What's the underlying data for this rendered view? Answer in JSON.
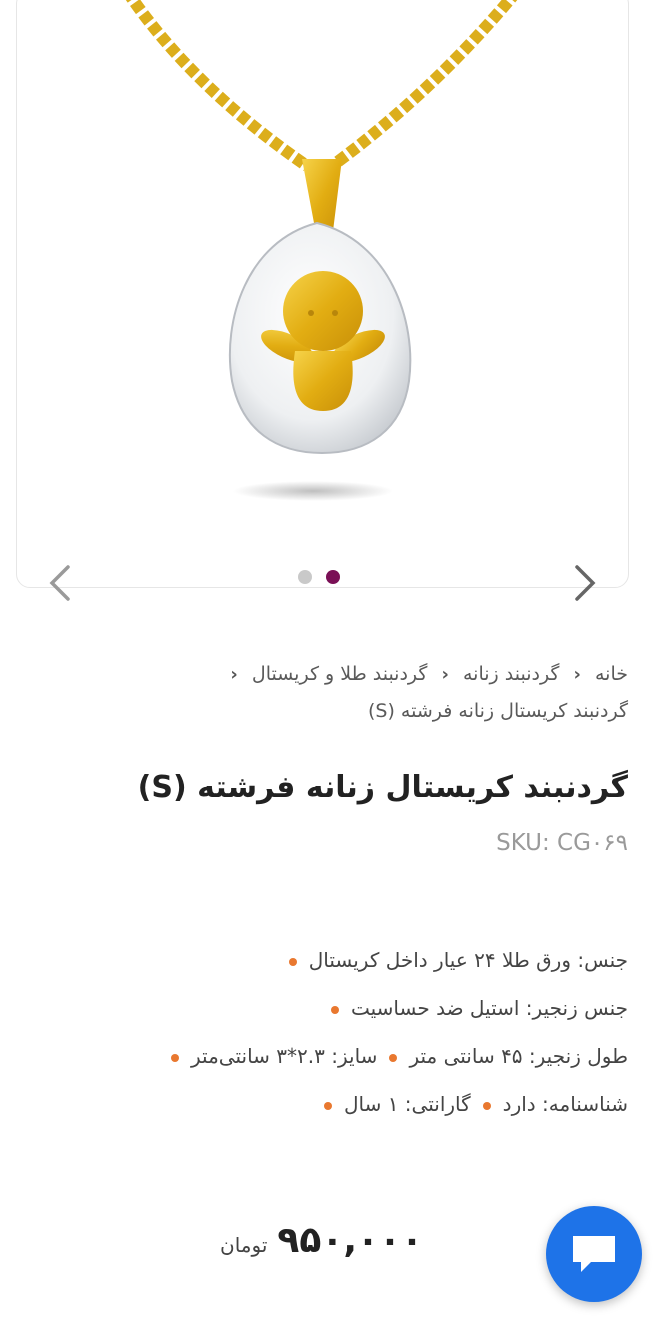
{
  "gallery": {
    "image_alt": "angel crystal pendant necklace",
    "dots": [
      {
        "active": false
      },
      {
        "active": true
      }
    ]
  },
  "breadcrumb": {
    "items": [
      "خانه",
      "گردنبند زنانه",
      "گردنبند طلا و کریستال",
      "گردنبند کریستال زنانه فرشته (S)"
    ]
  },
  "product": {
    "title": "گردنبند کریستال زنانه فرشته (S)",
    "sku": "SKU: CG۰۶۹",
    "specs": {
      "material": "جنس: ورق طلا ۲۴ عیار داخل کریستال",
      "chain_material": "جنس زنجیر: استیل ضد حساسیت",
      "chain_length": "طول زنجیر: ۴۵ سانتی متر",
      "size": "سایز: ۲.۳*۳ سانتی‌متر",
      "certificate": "شناسنامه: دارد",
      "warranty": "گارانتی: ۱ سال"
    },
    "price": "۹۵۰,۰۰۰",
    "currency": "تومان"
  },
  "colors": {
    "accent": "#7a1056",
    "bullet": "#e9782f",
    "chat": "#1e73e8"
  },
  "icons": {
    "prev": "chevron-left-icon",
    "next": "chevron-right-icon",
    "chat": "chat-bubble-icon"
  }
}
